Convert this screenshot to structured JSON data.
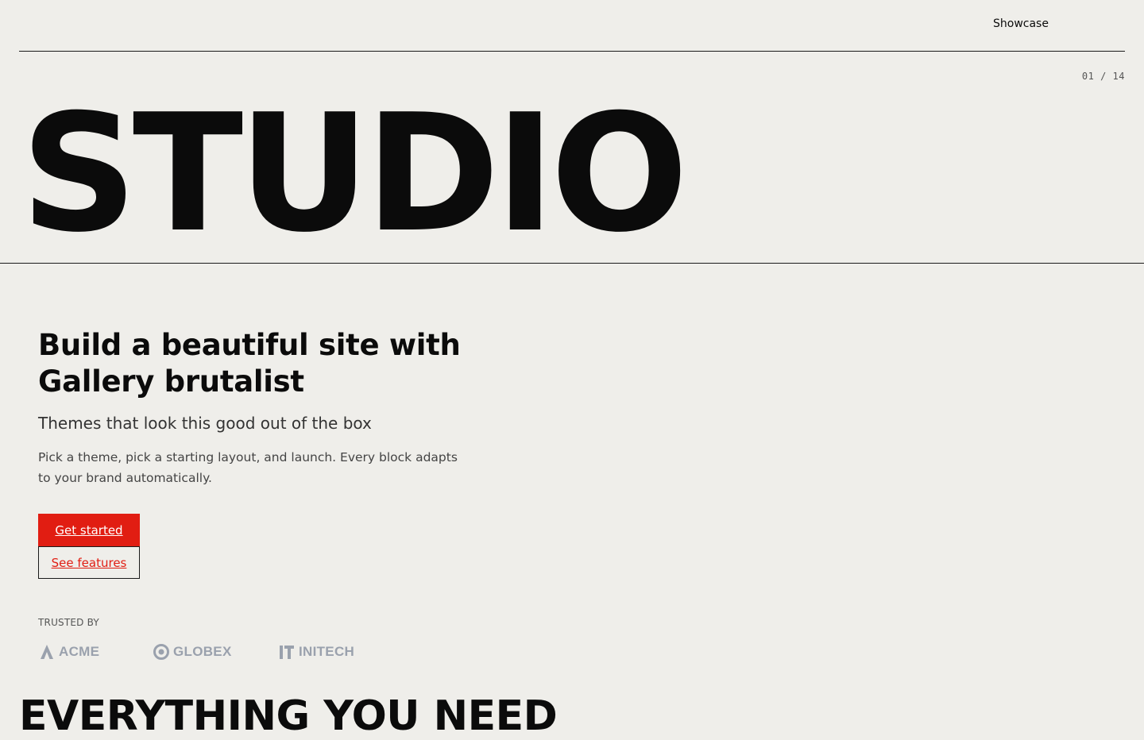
{
  "nav": {
    "showcase_label": "Showcase"
  },
  "hero": {
    "counter": "01 / 14",
    "word": "STUDIO"
  },
  "intro": {
    "headline": "Build a beautiful site with Gallery brutalist",
    "subhead": "Themes that look this good out of the box",
    "body": "Pick a theme, pick a starting layout, and launch. Every block adapts to your brand automatically.",
    "primary_cta": "Get started",
    "secondary_cta": "See features"
  },
  "trusted": {
    "label": "TRUSTED BY",
    "logos": [
      {
        "name": "ACME",
        "icon": "triangle-a-icon"
      },
      {
        "name": "GLOBEX",
        "icon": "ring-icon"
      },
      {
        "name": "INITECH",
        "icon": "bars-icon"
      }
    ]
  },
  "next_section": {
    "heading": "EVERYTHING YOU NEED"
  },
  "colors": {
    "background": "#efeeea",
    "ink": "#0b0b0b",
    "accent": "#e11d12",
    "logo_gray": "#9aa1ad"
  }
}
